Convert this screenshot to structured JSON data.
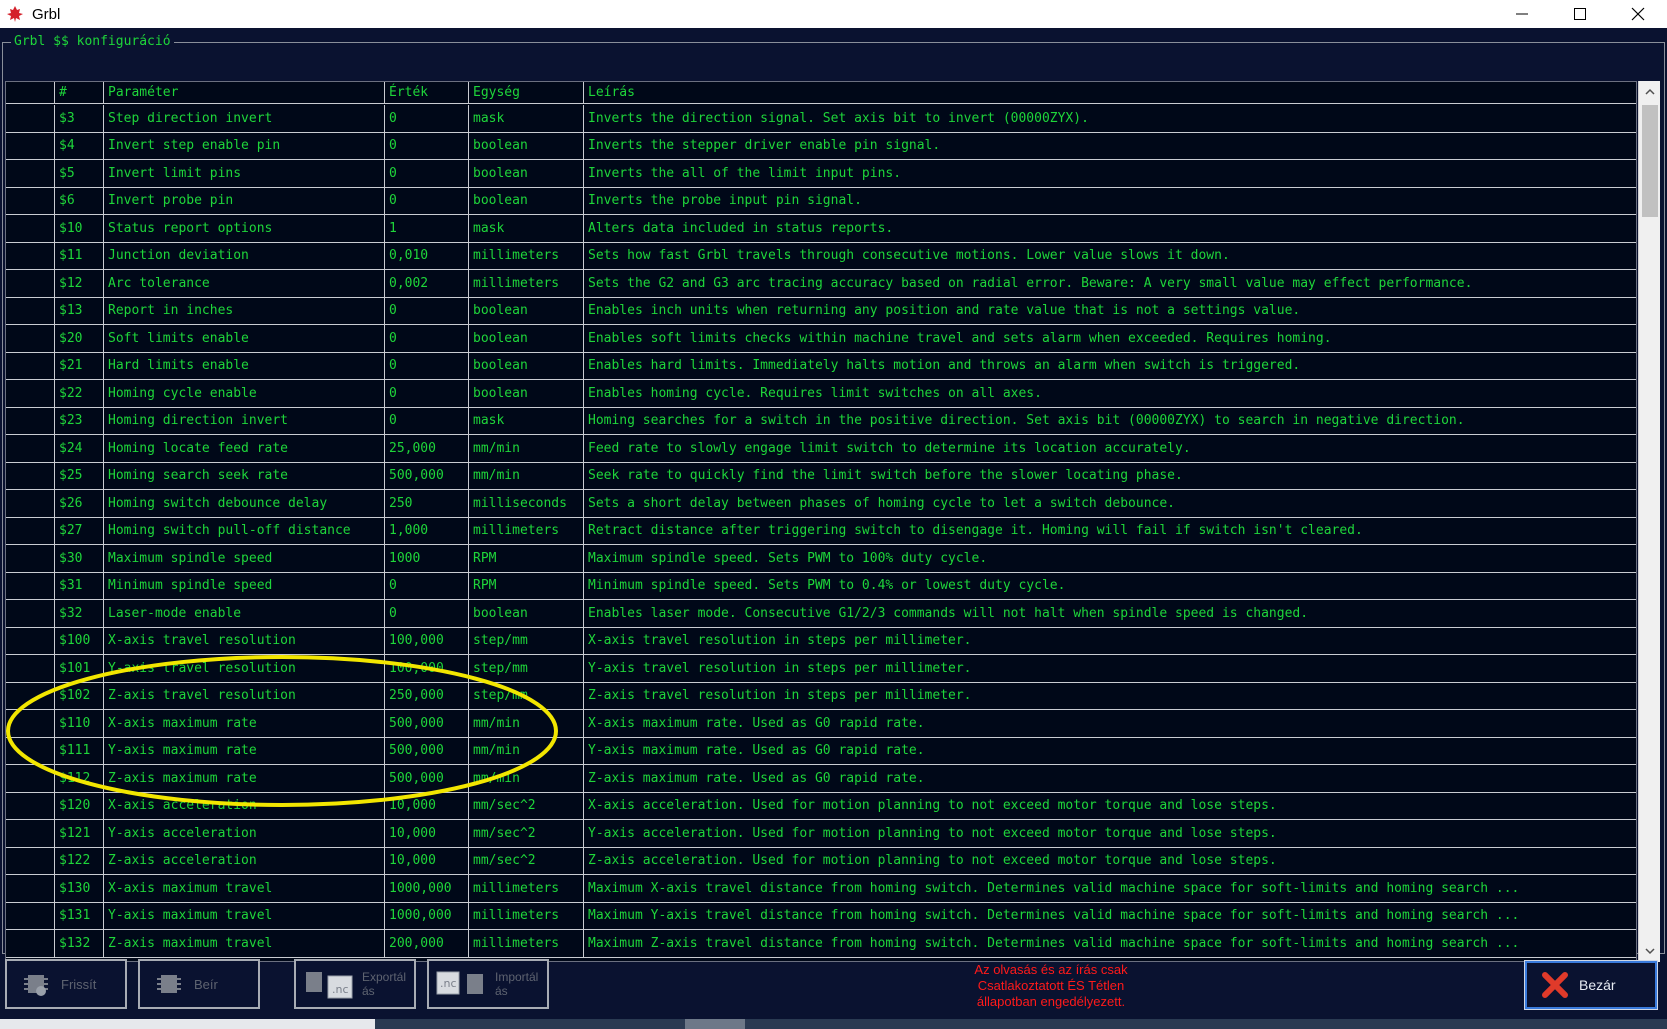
{
  "window": {
    "title": "Grbl",
    "minimize_glyph": "–",
    "maximize_glyph": "☐",
    "close_glyph": "✕"
  },
  "group": {
    "title": "Grbl $$ konfiguráció"
  },
  "table": {
    "headers": [
      "#",
      "Paraméter",
      "Érték",
      "Egység",
      "Leírás"
    ],
    "rows": [
      {
        "num": "$3",
        "name": "Step direction invert",
        "value": "0",
        "unit": "mask",
        "desc": "Inverts the direction signal. Set axis bit to invert (00000ZYX)."
      },
      {
        "num": "$4",
        "name": "Invert step enable pin",
        "value": "0",
        "unit": "boolean",
        "desc": "Inverts the stepper driver enable pin signal."
      },
      {
        "num": "$5",
        "name": "Invert limit pins",
        "value": "0",
        "unit": "boolean",
        "desc": "Inverts the all of the limit input pins."
      },
      {
        "num": "$6",
        "name": "Invert probe pin",
        "value": "0",
        "unit": "boolean",
        "desc": "Inverts the probe input pin signal."
      },
      {
        "num": "$10",
        "name": "Status report options",
        "value": "1",
        "unit": "mask",
        "desc": "Alters data included in status reports."
      },
      {
        "num": "$11",
        "name": "Junction deviation",
        "value": "0,010",
        "unit": "millimeters",
        "desc": "Sets how fast Grbl travels through consecutive motions. Lower value slows it down."
      },
      {
        "num": "$12",
        "name": "Arc tolerance",
        "value": "0,002",
        "unit": "millimeters",
        "desc": "Sets the G2 and G3 arc tracing accuracy based on radial error. Beware: A very small value may effect performance."
      },
      {
        "num": "$13",
        "name": "Report in inches",
        "value": "0",
        "unit": "boolean",
        "desc": "Enables inch units when returning any position and rate value that is not a settings value."
      },
      {
        "num": "$20",
        "name": "Soft limits enable",
        "value": "0",
        "unit": "boolean",
        "desc": "Enables soft limits checks within machine travel and sets alarm when exceeded. Requires homing."
      },
      {
        "num": "$21",
        "name": "Hard limits enable",
        "value": "0",
        "unit": "boolean",
        "desc": "Enables hard limits. Immediately halts motion and throws an alarm when switch is triggered."
      },
      {
        "num": "$22",
        "name": "Homing cycle enable",
        "value": "0",
        "unit": "boolean",
        "desc": "Enables homing cycle. Requires limit switches on all axes."
      },
      {
        "num": "$23",
        "name": "Homing direction invert",
        "value": "0",
        "unit": "mask",
        "desc": "Homing searches for a switch in the positive direction. Set axis bit (00000ZYX) to search in negative direction."
      },
      {
        "num": "$24",
        "name": "Homing locate feed rate",
        "value": "25,000",
        "unit": "mm/min",
        "desc": "Feed rate to slowly engage limit switch to determine its location accurately."
      },
      {
        "num": "$25",
        "name": "Homing search seek rate",
        "value": "500,000",
        "unit": "mm/min",
        "desc": "Seek rate to quickly find the limit switch before the slower locating phase."
      },
      {
        "num": "$26",
        "name": "Homing switch debounce delay",
        "value": "250",
        "unit": "milliseconds",
        "desc": "Sets a short delay between phases of homing cycle to let a switch debounce."
      },
      {
        "num": "$27",
        "name": "Homing switch pull-off distance",
        "value": "1,000",
        "unit": "millimeters",
        "desc": "Retract distance after triggering switch to disengage it. Homing will fail if switch isn't cleared."
      },
      {
        "num": "$30",
        "name": "Maximum spindle speed",
        "value": "1000",
        "unit": "RPM",
        "desc": "Maximum spindle speed. Sets PWM to 100% duty cycle."
      },
      {
        "num": "$31",
        "name": "Minimum spindle speed",
        "value": "0",
        "unit": "RPM",
        "desc": "Minimum spindle speed. Sets PWM to 0.4% or lowest duty cycle."
      },
      {
        "num": "$32",
        "name": "Laser-mode enable",
        "value": "0",
        "unit": "boolean",
        "desc": "Enables laser mode. Consecutive G1/2/3 commands will not halt when spindle speed is changed."
      },
      {
        "num": "$100",
        "name": "X-axis travel resolution",
        "value": "100,000",
        "unit": "step/mm",
        "desc": "X-axis travel resolution in steps per millimeter."
      },
      {
        "num": "$101",
        "name": "Y-axis travel resolution",
        "value": "100,000",
        "unit": "step/mm",
        "desc": "Y-axis travel resolution in steps per millimeter."
      },
      {
        "num": "$102",
        "name": "Z-axis travel resolution",
        "value": "250,000",
        "unit": "step/mm",
        "desc": "Z-axis travel resolution in steps per millimeter."
      },
      {
        "num": "$110",
        "name": "X-axis maximum rate",
        "value": "500,000",
        "unit": "mm/min",
        "desc": "X-axis maximum rate. Used as G0 rapid rate."
      },
      {
        "num": "$111",
        "name": "Y-axis maximum rate",
        "value": "500,000",
        "unit": "mm/min",
        "desc": "Y-axis maximum rate. Used as G0 rapid rate."
      },
      {
        "num": "$112",
        "name": "Z-axis maximum rate",
        "value": "500,000",
        "unit": "mm/min",
        "desc": "Z-axis maximum rate. Used as G0 rapid rate."
      },
      {
        "num": "$120",
        "name": "X-axis acceleration",
        "value": "10,000",
        "unit": "mm/sec^2",
        "desc": "X-axis acceleration. Used for motion planning to not exceed motor torque and lose steps."
      },
      {
        "num": "$121",
        "name": "Y-axis acceleration",
        "value": "10,000",
        "unit": "mm/sec^2",
        "desc": "Y-axis acceleration. Used for motion planning to not exceed motor torque and lose steps."
      },
      {
        "num": "$122",
        "name": "Z-axis acceleration",
        "value": "10,000",
        "unit": "mm/sec^2",
        "desc": "Z-axis acceleration. Used for motion planning to not exceed motor torque and lose steps."
      },
      {
        "num": "$130",
        "name": "X-axis maximum travel",
        "value": "1000,000",
        "unit": "millimeters",
        "desc": "Maximum X-axis travel distance from homing switch. Determines valid machine space for soft-limits and homing search ..."
      },
      {
        "num": "$131",
        "name": "Y-axis maximum travel",
        "value": "1000,000",
        "unit": "millimeters",
        "desc": "Maximum Y-axis travel distance from homing switch. Determines valid machine space for soft-limits and homing search ..."
      },
      {
        "num": "$132",
        "name": "Z-axis maximum travel",
        "value": "200,000",
        "unit": "millimeters",
        "desc": "Maximum Z-axis travel distance from homing switch. Determines valid machine space for soft-limits and homing search ..."
      }
    ]
  },
  "toolbar": {
    "refresh_label": "Frissít",
    "write_label": "Beír",
    "export_label": "Exportál\nás",
    "import_label": "Importál\nás",
    "nc_label": ".nc",
    "nc_label_2": ".nc"
  },
  "notice": "Az olvasás és az írás csak Csatlakoztatott ÉS Tétlen állapotban engedélyezett.",
  "close_label": "Bezár",
  "colors": {
    "grid_text": "#1ed63a",
    "background": "#0a1230",
    "notice_text": "#ff1a1a",
    "highlight": "#f2e600"
  },
  "icons": {
    "app": "maple-leaf-icon",
    "refresh": "chip-refresh-icon",
    "write": "chip-write-icon",
    "export": "chip-export-icon",
    "import": "chip-import-icon",
    "close": "red-x-icon"
  }
}
